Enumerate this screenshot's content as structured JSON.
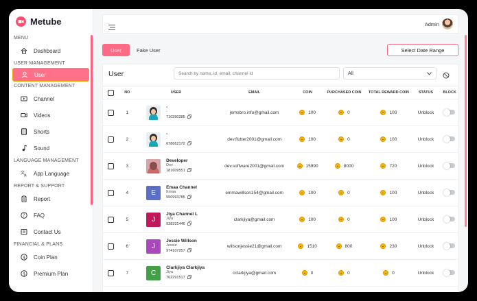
{
  "app": {
    "name": "Metube",
    "accent": "#ff6b84"
  },
  "sidebar": {
    "sections": [
      {
        "title": "MENU",
        "items": [
          {
            "label": "Dashboard",
            "icon": "home-icon"
          }
        ]
      },
      {
        "title": "USER MANAGEMENT",
        "items": [
          {
            "label": "User",
            "icon": "user-icon",
            "active": true
          }
        ]
      },
      {
        "title": "CONTENT MANAGEMENT",
        "items": [
          {
            "label": "Channel",
            "icon": "channel-icon"
          },
          {
            "label": "Videos",
            "icon": "video-icon"
          },
          {
            "label": "Shorts",
            "icon": "shorts-icon"
          },
          {
            "label": "Sound",
            "icon": "music-icon"
          }
        ]
      },
      {
        "title": "LANGUAGE MANAGEMENT",
        "items": [
          {
            "label": "App Language",
            "icon": "translate-icon"
          }
        ]
      },
      {
        "title": "REPORT & SUPPORT",
        "items": [
          {
            "label": "Report",
            "icon": "report-icon"
          },
          {
            "label": "FAQ",
            "icon": "help-icon"
          },
          {
            "label": "Contact Us",
            "icon": "contact-icon"
          }
        ]
      },
      {
        "title": "FINANCIAL & PLANS",
        "items": [
          {
            "label": "Coin Plan",
            "icon": "coin-plan-icon"
          },
          {
            "label": "Premium Plan",
            "icon": "premium-plan-icon"
          }
        ]
      }
    ]
  },
  "topbar": {
    "admin_label": "Admin"
  },
  "tabs": {
    "user": "User",
    "fake_user": "Fake User",
    "date_range": "Select Date Range"
  },
  "card": {
    "title": "User",
    "search_placeholder": "Search by name, id, email, channel id",
    "filter_value": "All"
  },
  "table": {
    "headers": [
      "NO",
      "USER",
      "EMAIL",
      "COIN",
      "PURCHASED COIN",
      "TOTAL REWARD COIN",
      "STATUS",
      "BLOCK"
    ],
    "rows": [
      {
        "no": "1",
        "name": "-",
        "sub": "-",
        "id": "710390285",
        "email": "jemsbro.info@gmail.com",
        "coin": "100",
        "purchased": "0",
        "reward": "100",
        "status": "Unblock",
        "pic": "photo"
      },
      {
        "no": "2",
        "name": "-",
        "sub": "-",
        "id": "678662172",
        "email": "dev.flutter2001@gmail.com",
        "coin": "100",
        "purchased": "0",
        "reward": "100",
        "status": "Unblock",
        "pic": "photo"
      },
      {
        "no": "3",
        "name": "Developer",
        "sub": "Dev",
        "id": "181609551",
        "email": "dev.software2001@gmail.com",
        "coin": "15990",
        "purchased": "8000",
        "reward": "720",
        "status": "Unblock",
        "pic": "photo2"
      },
      {
        "no": "4",
        "name": "Emaa Channel",
        "sub": "Emaa",
        "id": "550993785",
        "email": "emmawillson154@gmail.com",
        "coin": "100",
        "purchased": "0",
        "reward": "100",
        "status": "Unblock",
        "pic": "letter",
        "letter": "E",
        "color": "#5b6fc7"
      },
      {
        "no": "5",
        "name": "Jiya Channel L",
        "sub": "Jiya",
        "id": "938331446",
        "email": "clarkjiya@gmail.com",
        "coin": "100",
        "purchased": "0",
        "reward": "100",
        "status": "Unblock",
        "pic": "letter",
        "letter": "J",
        "color": "#c2185b"
      },
      {
        "no": "6",
        "name": "Jessie Willson",
        "sub": "Jessie",
        "id": "974107257",
        "email": "willsonjessie21@gmail.com",
        "coin": "1510",
        "purchased": "800",
        "reward": "230",
        "status": "Unblock",
        "pic": "letter",
        "letter": "J",
        "color": "#ab47bc"
      },
      {
        "no": "7",
        "name": "Clarkjiya Clarkjiya",
        "sub": "Jiya",
        "id": "762291517",
        "email": "cclarkjiya@gmail.com",
        "coin": "0",
        "purchased": "0",
        "reward": "0",
        "status": "Unblock",
        "pic": "letter",
        "letter": "C",
        "color": "#43a047"
      }
    ]
  }
}
